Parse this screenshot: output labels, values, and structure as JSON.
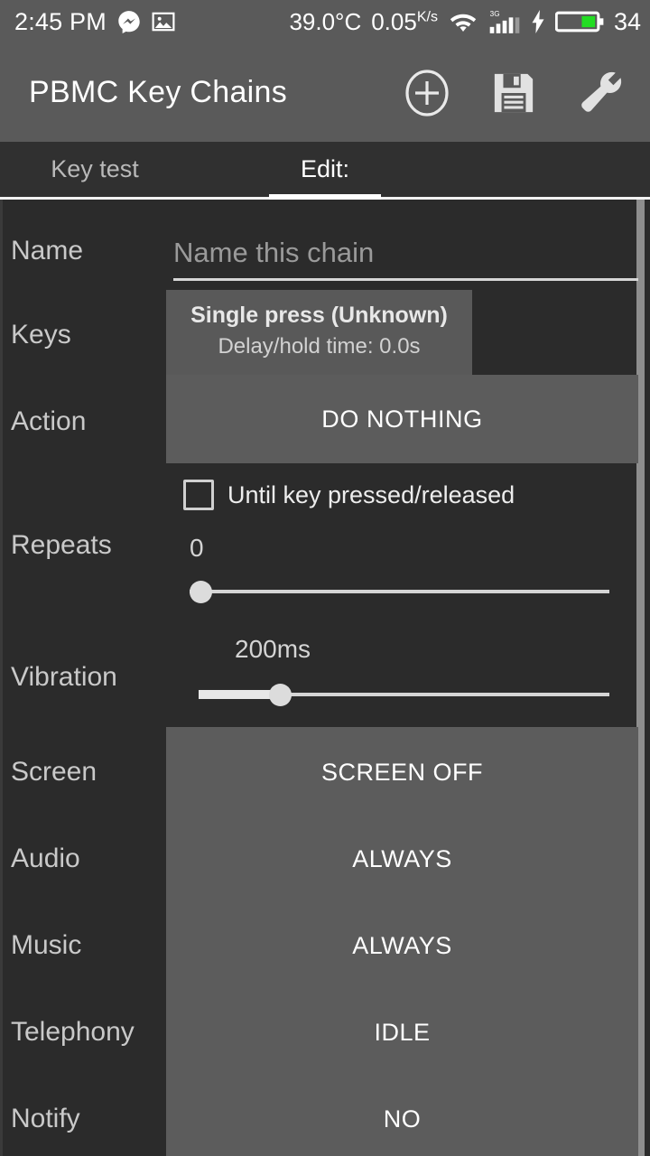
{
  "status_bar": {
    "clock": "2:45 PM",
    "icons_left": [
      "messenger-icon",
      "gallery-icon"
    ],
    "temperature": "39.0°C",
    "network_speed_value": "0.05",
    "network_speed_unit": "K/s",
    "wifi": "wifi-icon",
    "signal_label": "3G",
    "signal_bars_filled": 4,
    "signal_bars_total": 5,
    "charging": true,
    "battery_percent": "34",
    "battery_fill_color": "#22dd22",
    "background_color": "#5a5a5a"
  },
  "title_bar": {
    "title": "PBMC Key Chains",
    "actions": [
      {
        "name": "add-button",
        "icon": "plus-circle-icon"
      },
      {
        "name": "save-button",
        "icon": "floppy-disk-icon"
      },
      {
        "name": "settings-button",
        "icon": "wrench-icon"
      }
    ],
    "background_color": "#5a5a5a"
  },
  "tabs": [
    {
      "label": "Key test",
      "active": false
    },
    {
      "label": "Edit:",
      "active": true
    }
  ],
  "form": {
    "name": {
      "label": "Name",
      "value": "",
      "placeholder": "Name this chain"
    },
    "keys": {
      "label": "Keys",
      "title": "Single press (Unknown)",
      "subtitle": "Delay/hold time: 0.0s"
    },
    "action": {
      "label": "Action",
      "value": "DO NOTHING"
    },
    "until_key": {
      "label": "Until key pressed/released",
      "checked": false
    },
    "repeats": {
      "label": "Repeats",
      "value": "0",
      "slider_percent": 0
    },
    "vibration": {
      "label": "Vibration",
      "value": "200ms",
      "slider_percent": 19
    }
  },
  "options": [
    {
      "label": "Screen",
      "value": "SCREEN OFF"
    },
    {
      "label": "Audio",
      "value": "ALWAYS"
    },
    {
      "label": "Music",
      "value": "ALWAYS"
    },
    {
      "label": "Telephony",
      "value": "IDLE"
    },
    {
      "label": "Notify",
      "value": "NO"
    }
  ]
}
